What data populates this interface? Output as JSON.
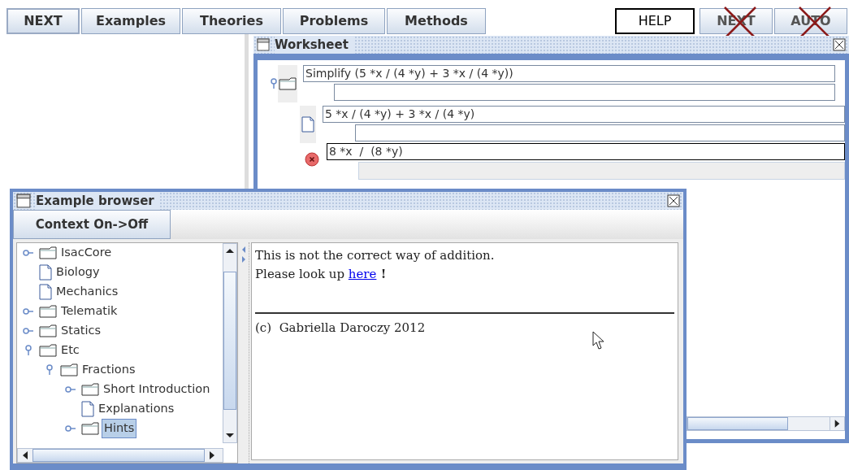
{
  "toolbar": {
    "buttons": [
      {
        "label": "NEXT",
        "kind": "raised",
        "disabled": false
      },
      {
        "label": "Examples",
        "kind": "tab",
        "disabled": false
      },
      {
        "label": "Theories",
        "kind": "tab",
        "disabled": false
      },
      {
        "label": "Problems",
        "kind": "tab",
        "disabled": false
      },
      {
        "label": "Methods",
        "kind": "tab",
        "disabled": false
      },
      {
        "label": "HELP",
        "kind": "outlined",
        "disabled": false
      },
      {
        "label": "NEXT",
        "kind": "tab",
        "disabled": true
      },
      {
        "label": "AUTO",
        "kind": "tab",
        "disabled": true
      }
    ]
  },
  "worksheet": {
    "title": "Worksheet",
    "steps": [
      {
        "kind": "folder",
        "formula": "Simplify (5 *x / (4 *y) + 3 *x / (4 *y))"
      },
      {
        "kind": "document",
        "formula": "5 *x / (4 *y) + 3 *x / (4 *y)"
      },
      {
        "kind": "error",
        "formula": "8 *x  /  (8 *y)"
      }
    ]
  },
  "example_browser": {
    "title": "Example browser",
    "button": "Context On->Off",
    "tree": [
      {
        "label": "IsacCore",
        "kind": "folder",
        "expanded": false,
        "selected": false
      },
      {
        "label": "Biology",
        "kind": "document",
        "selected": false
      },
      {
        "label": "Mechanics",
        "kind": "document",
        "selected": false
      },
      {
        "label": "Telematik",
        "kind": "folder",
        "expanded": false,
        "selected": false
      },
      {
        "label": "Statics",
        "kind": "folder",
        "expanded": false,
        "selected": false
      },
      {
        "label": "Etc",
        "kind": "folder",
        "expanded": true,
        "selected": false,
        "children": [
          {
            "label": "Fractions",
            "kind": "folder",
            "expanded": true,
            "selected": false,
            "children": [
              {
                "label": "Short Introduction",
                "kind": "folder",
                "expanded": false,
                "selected": false
              },
              {
                "label": "Explanations",
                "kind": "document",
                "selected": false
              },
              {
                "label": "Hints",
                "kind": "folder",
                "expanded": false,
                "selected": true
              }
            ]
          }
        ]
      }
    ],
    "message": {
      "text": "This is not the correct way of addition.",
      "prompt": "Please look up ",
      "link": "here",
      "after": " !",
      "footer": "(c)  Gabriella Daroczy 2012"
    }
  }
}
